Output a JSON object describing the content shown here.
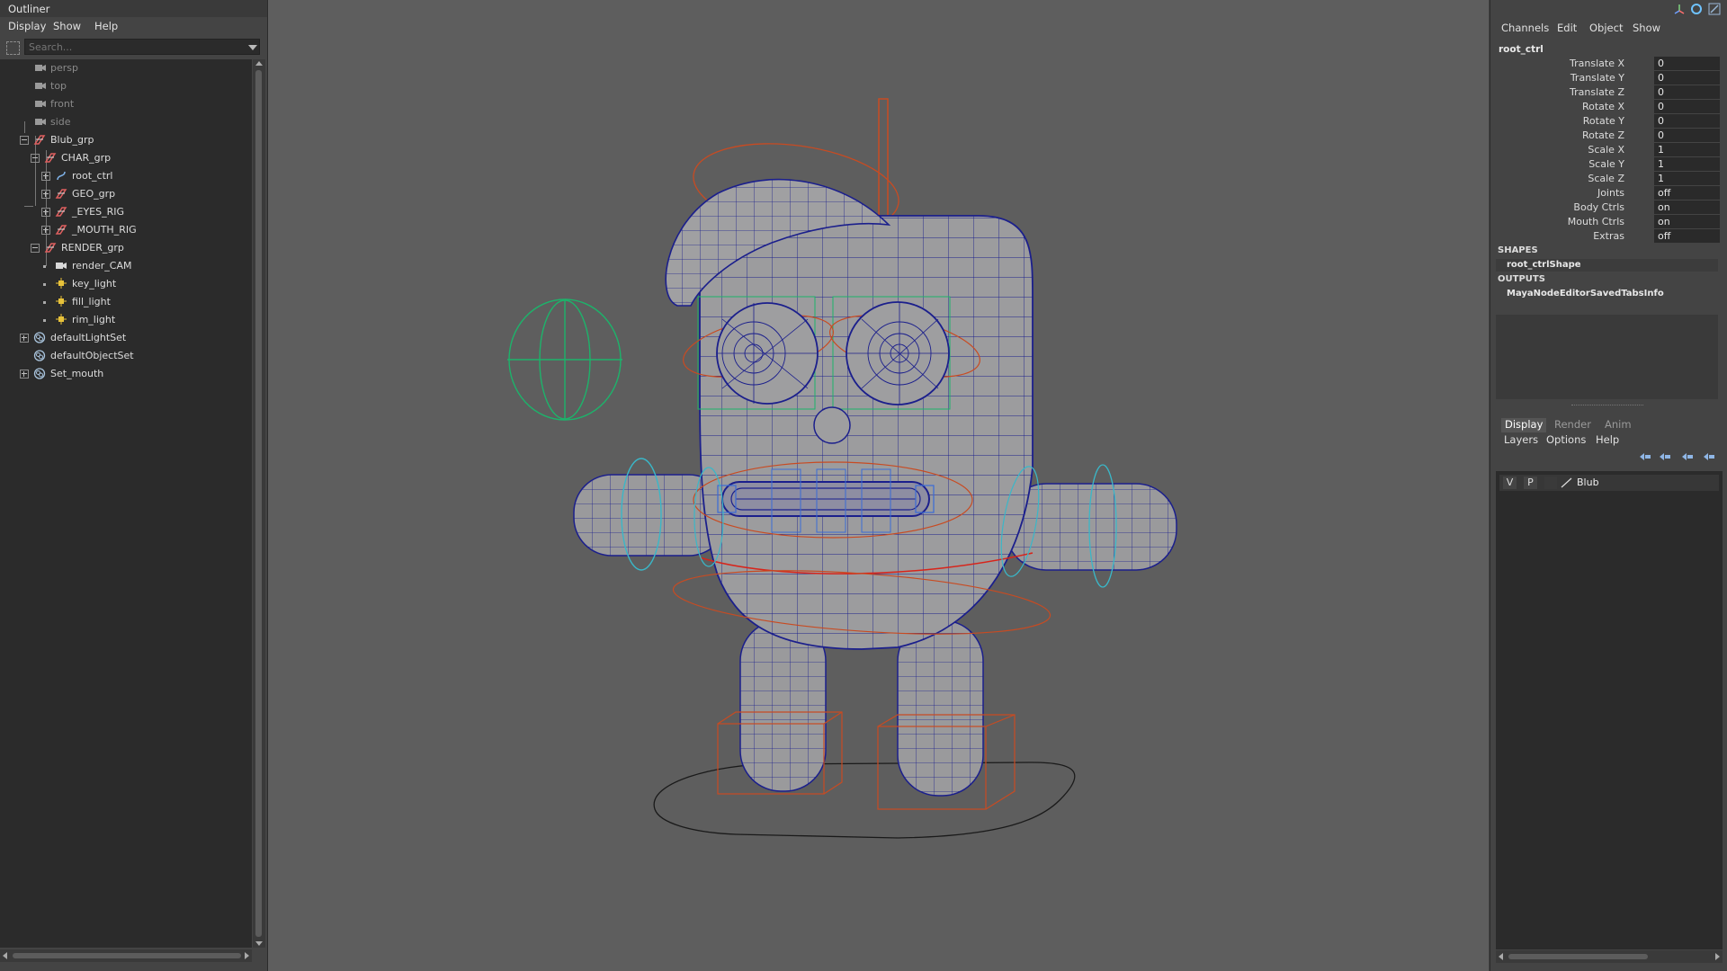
{
  "outliner": {
    "title": "Outliner",
    "menu": [
      "Display",
      "Show",
      "Help"
    ],
    "search_placeholder": "Search...",
    "items": [
      {
        "label": "persp",
        "icon": "camera-icon",
        "dim": true
      },
      {
        "label": "top",
        "icon": "camera-icon",
        "dim": true
      },
      {
        "label": "front",
        "icon": "camera-icon",
        "dim": true
      },
      {
        "label": "side",
        "icon": "camera-icon",
        "dim": true
      },
      {
        "label": "Blub_grp",
        "icon": "group-icon",
        "expanded": true
      },
      {
        "label": "CHAR_grp",
        "icon": "group-icon",
        "expanded": true
      },
      {
        "label": "root_ctrl",
        "icon": "curve-icon",
        "expanded": false
      },
      {
        "label": "GEO_grp",
        "icon": "group-icon",
        "expanded": false
      },
      {
        "label": "_EYES_RIG",
        "icon": "group-icon",
        "expanded": false
      },
      {
        "label": "_MOUTH_RIG",
        "icon": "group-icon",
        "expanded": false
      },
      {
        "label": "RENDER_grp",
        "icon": "group-icon",
        "expanded": true
      },
      {
        "label": "render_CAM",
        "icon": "camera-icon"
      },
      {
        "label": "key_light",
        "icon": "light-icon"
      },
      {
        "label": "fill_light",
        "icon": "light-icon"
      },
      {
        "label": "rim_light",
        "icon": "light-icon"
      },
      {
        "label": "defaultLightSet",
        "icon": "set-icon",
        "expanded": false
      },
      {
        "label": "defaultObjectSet",
        "icon": "set-icon"
      },
      {
        "label": "Set_mouth",
        "icon": "set-icon",
        "expanded": false
      }
    ]
  },
  "channel_box": {
    "menu": [
      "Channels",
      "Edit",
      "Object",
      "Show"
    ],
    "object_name": "root_ctrl",
    "attributes": [
      {
        "name": "Translate X",
        "value": "0"
      },
      {
        "name": "Translate Y",
        "value": "0"
      },
      {
        "name": "Translate Z",
        "value": "0"
      },
      {
        "name": "Rotate X",
        "value": "0"
      },
      {
        "name": "Rotate Y",
        "value": "0"
      },
      {
        "name": "Rotate Z",
        "value": "0"
      },
      {
        "name": "Scale X",
        "value": "1"
      },
      {
        "name": "Scale Y",
        "value": "1"
      },
      {
        "name": "Scale Z",
        "value": "1"
      },
      {
        "name": "Joints",
        "value": "off"
      },
      {
        "name": "Body Ctrls",
        "value": "on"
      },
      {
        "name": "Mouth Ctrls",
        "value": "on"
      },
      {
        "name": "Extras",
        "value": "off"
      }
    ],
    "shapes_header": "SHAPES",
    "shapes": [
      "root_ctrlShape"
    ],
    "outputs_header": "OUTPUTS",
    "outputs": [
      "MayaNodeEditorSavedTabsInfo"
    ]
  },
  "layer_editor": {
    "tabs": [
      "Display",
      "Render",
      "Anim"
    ],
    "active_tab": "Display",
    "menu": [
      "Layers",
      "Options",
      "Help"
    ],
    "layers": [
      {
        "visible": "V",
        "playback": "P",
        "name": "Blub"
      }
    ]
  },
  "colors": {
    "viewport_bg": "#5e5e5e",
    "wireframe": "#1b1f8c",
    "control_red": "#c84b22",
    "control_cyan": "#3ab7c8",
    "control_green": "#1db36b"
  }
}
